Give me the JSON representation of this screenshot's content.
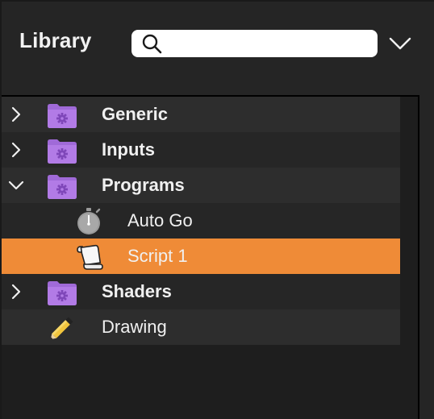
{
  "header": {
    "title": "Library",
    "search": {
      "value": "",
      "placeholder": ""
    },
    "menu_icon": "chevron-down-icon"
  },
  "colors": {
    "background": "#252525",
    "row_odd": "#2d2d2d",
    "row_even": "#262626",
    "selection": "#ef8b37",
    "folder": "#a06ad8",
    "text": "#f0f0f0"
  },
  "tree": [
    {
      "label": "Generic",
      "kind": "folder",
      "depth": 0,
      "expanded": false,
      "selected": false,
      "icon": "folder-gear-icon"
    },
    {
      "label": "Inputs",
      "kind": "folder",
      "depth": 0,
      "expanded": false,
      "selected": false,
      "icon": "folder-gear-icon"
    },
    {
      "label": "Programs",
      "kind": "folder",
      "depth": 0,
      "expanded": true,
      "selected": false,
      "icon": "folder-gear-icon"
    },
    {
      "label": "Auto Go",
      "kind": "item",
      "depth": 1,
      "expanded": null,
      "selected": false,
      "icon": "stopwatch-icon"
    },
    {
      "label": "Script 1",
      "kind": "item",
      "depth": 1,
      "expanded": null,
      "selected": true,
      "icon": "script-scroll-icon"
    },
    {
      "label": "Shaders",
      "kind": "folder",
      "depth": 0,
      "expanded": false,
      "selected": false,
      "icon": "folder-gear-icon"
    },
    {
      "label": "Drawing",
      "kind": "item",
      "depth": 0,
      "expanded": null,
      "selected": false,
      "icon": "pencil-icon"
    }
  ]
}
